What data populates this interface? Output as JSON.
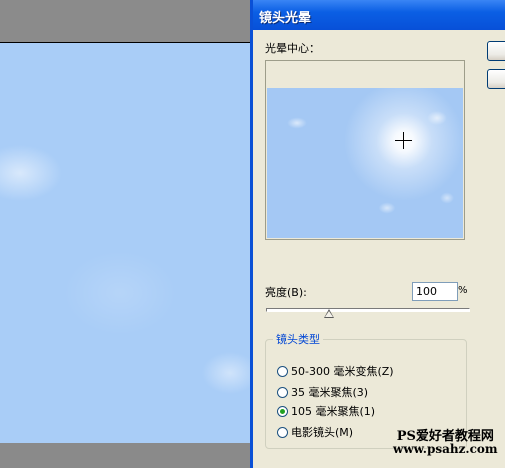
{
  "dialog": {
    "title": "镜头光晕",
    "flare_center_label": "光晕中心：",
    "brightness_label": "亮度(B):",
    "brightness_value": "100",
    "brightness_unit": "%",
    "brightness_level_percent": 100,
    "lens_type_title": "镜头类型",
    "lens_options": [
      {
        "label": "50-300 毫米变焦(Z)",
        "checked": false
      },
      {
        "label": "35 毫米聚焦(3)",
        "checked": false
      },
      {
        "label": "105 毫米聚焦(1)",
        "checked": true
      },
      {
        "label": "电影镜头(M)",
        "checked": false
      }
    ]
  },
  "watermark": {
    "line1": "PS爱好者教程网",
    "line2": "www.psahz.com"
  }
}
